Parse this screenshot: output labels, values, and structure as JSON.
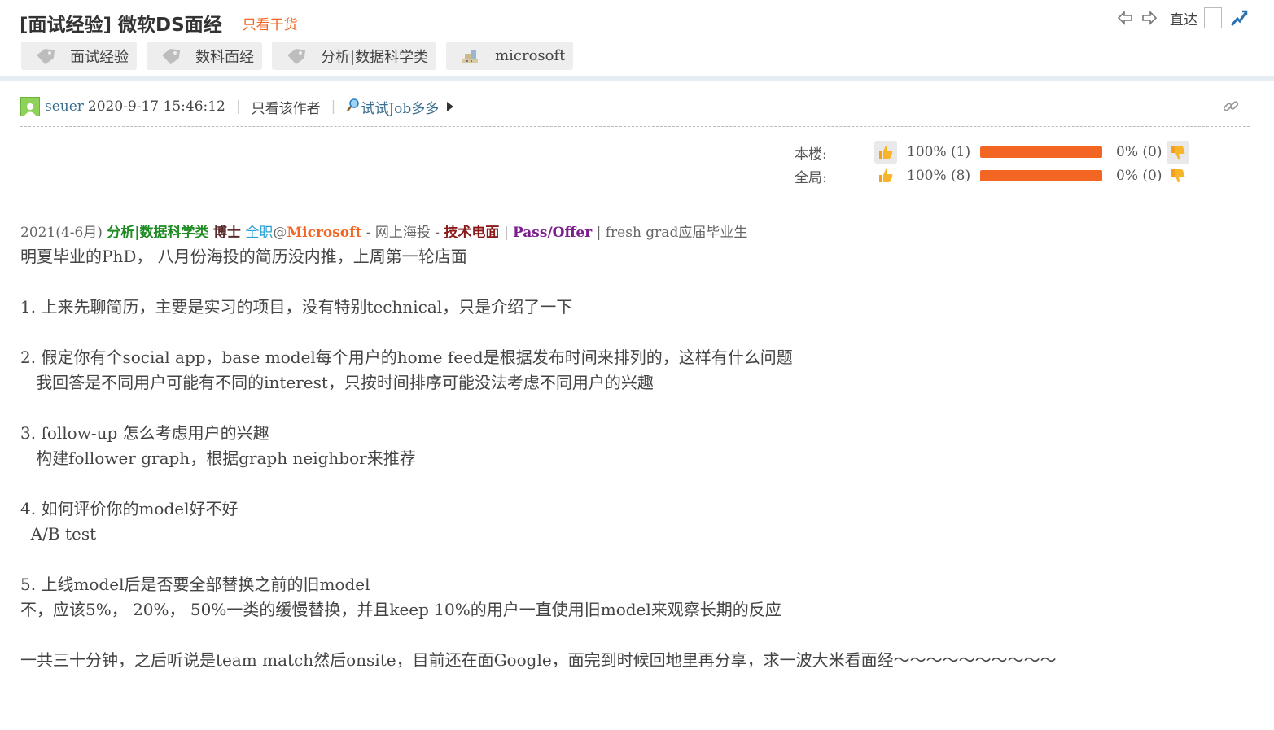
{
  "thread": {
    "title": "[面试经验] 微软DS面经",
    "only_goods": "只看干货",
    "direct_label": "直达"
  },
  "tags": [
    {
      "label": "面试经验",
      "icon": "tag-icon"
    },
    {
      "label": "数科面经",
      "icon": "tag-icon"
    },
    {
      "label": "分析|数据科学类",
      "icon": "tag-icon"
    },
    {
      "label": "microsoft",
      "icon": "building-icon"
    }
  ],
  "meta": {
    "author": "seuer",
    "time": "2020-9-17 15:46:12",
    "only_author": "只看该作者",
    "jobs_link": "试试Job多多"
  },
  "votes": {
    "floor": {
      "label": "本楼:",
      "up": "100% (1)",
      "up_fraction": 1.0,
      "down": "0% (0)"
    },
    "global": {
      "label": "全局:",
      "up": "100% (8)",
      "up_fraction": 1.0,
      "down": "0% (0)"
    }
  },
  "post": {
    "head": {
      "date": "2021(4-6月)",
      "cat": "分析|数据科学类",
      "degree": "博士",
      "fulltime": "全职",
      "at": "@",
      "company": "Microsoft",
      "dash1": "- 网上海投 -",
      "interview": "技术电面",
      "bar1": "|",
      "result": "Pass/Offer",
      "bar2": "| fresh grad应届毕业生"
    },
    "lines": [
      "明夏毕业的PhD， 八月份海投的简历没内推，上周第一轮店面",
      "",
      "1. 上来先聊简历，主要是实习的项目，没有特别technical，只是介绍了一下",
      "",
      "2. 假定你有个social app，base model每个用户的home feed是根据发布时间来排列的，这样有什么问题",
      "   我回答是不同用户可能有不同的interest，只按时间排序可能没法考虑不同用户的兴趣",
      "",
      "3. follow-up 怎么考虑用户的兴趣",
      "   构建follower graph，根据graph neighbor来推荐",
      "",
      "4. 如何评价你的model好不好",
      "  A/B test",
      "",
      "5. 上线model后是否要全部替换之前的旧model",
      "不，应该5%， 20%， 50%一类的缓慢替换，并且keep 10%的用户一直使用旧model来观察长期的反应",
      "",
      "一共三十分钟，之后听说是team match然后onsite，目前还在面Google，面完到时候回地里再分享，求一波大米看面经～～～～～～～～～～"
    ]
  }
}
